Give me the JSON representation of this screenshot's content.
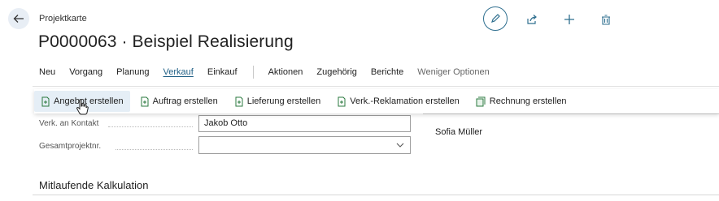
{
  "header": {
    "subtitle": "Projektkarte",
    "title": "P0000063 · Beispiel Realisierung"
  },
  "icons": {
    "back": "back-arrow-icon",
    "edit": "pencil-icon",
    "share": "share-icon",
    "new": "plus-icon",
    "delete": "trash-icon"
  },
  "menu": {
    "items": [
      "Neu",
      "Vorgang",
      "Planung",
      "Verkauf",
      "Einkauf",
      "Aktionen",
      "Zugehörig",
      "Berichte",
      "Weniger Optionen"
    ],
    "active": "Verkauf"
  },
  "actions": [
    {
      "label": "Angebot erstellen"
    },
    {
      "label": "Auftrag erstellen"
    },
    {
      "label": "Lieferung erstellen"
    },
    {
      "label": "Verk.-Reklamation erstellen"
    },
    {
      "label": "Rechnung erstellen"
    }
  ],
  "fields": {
    "contact_label": "Verk. an Kontakt",
    "contact_value": "Jakob Otto",
    "total_project_label": "Gesamtprojektnr.",
    "total_project_value": ""
  },
  "right_value": "Sofia Müller",
  "section_title": "Mitlaufende Kalkulation",
  "colors": {
    "accent": "#1f5f85",
    "action_icon": "#2b7a3f",
    "hover": "#e5eef6"
  }
}
